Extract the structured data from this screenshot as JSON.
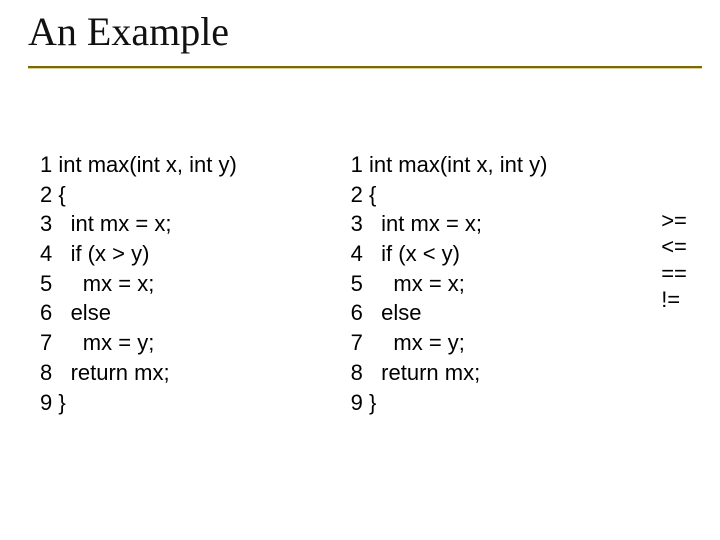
{
  "slide": {
    "title": "An Example"
  },
  "left_code": {
    "l1": "1 int max(int x, int y)",
    "l2": "2 {",
    "l3": "3   int mx = x;",
    "l4": "4   if (x > y)",
    "l5": "5     mx = x;",
    "l6": "6   else",
    "l7": "7     mx = y;",
    "l8": "8   return mx;",
    "l9": "9 }"
  },
  "right_code": {
    "l1": "1 int max(int x, int y)",
    "l2": "2 {",
    "l3": "3   int mx = x;",
    "l4": "4   if (x < y)",
    "l5": "5     mx = x;",
    "l6": "6   else",
    "l7": "7     mx = y;",
    "l8": "8   return mx;",
    "l9": "9 }"
  },
  "operators": {
    "o1": ">=",
    "o2": "<=",
    "o3": "==",
    "o4": "!="
  }
}
